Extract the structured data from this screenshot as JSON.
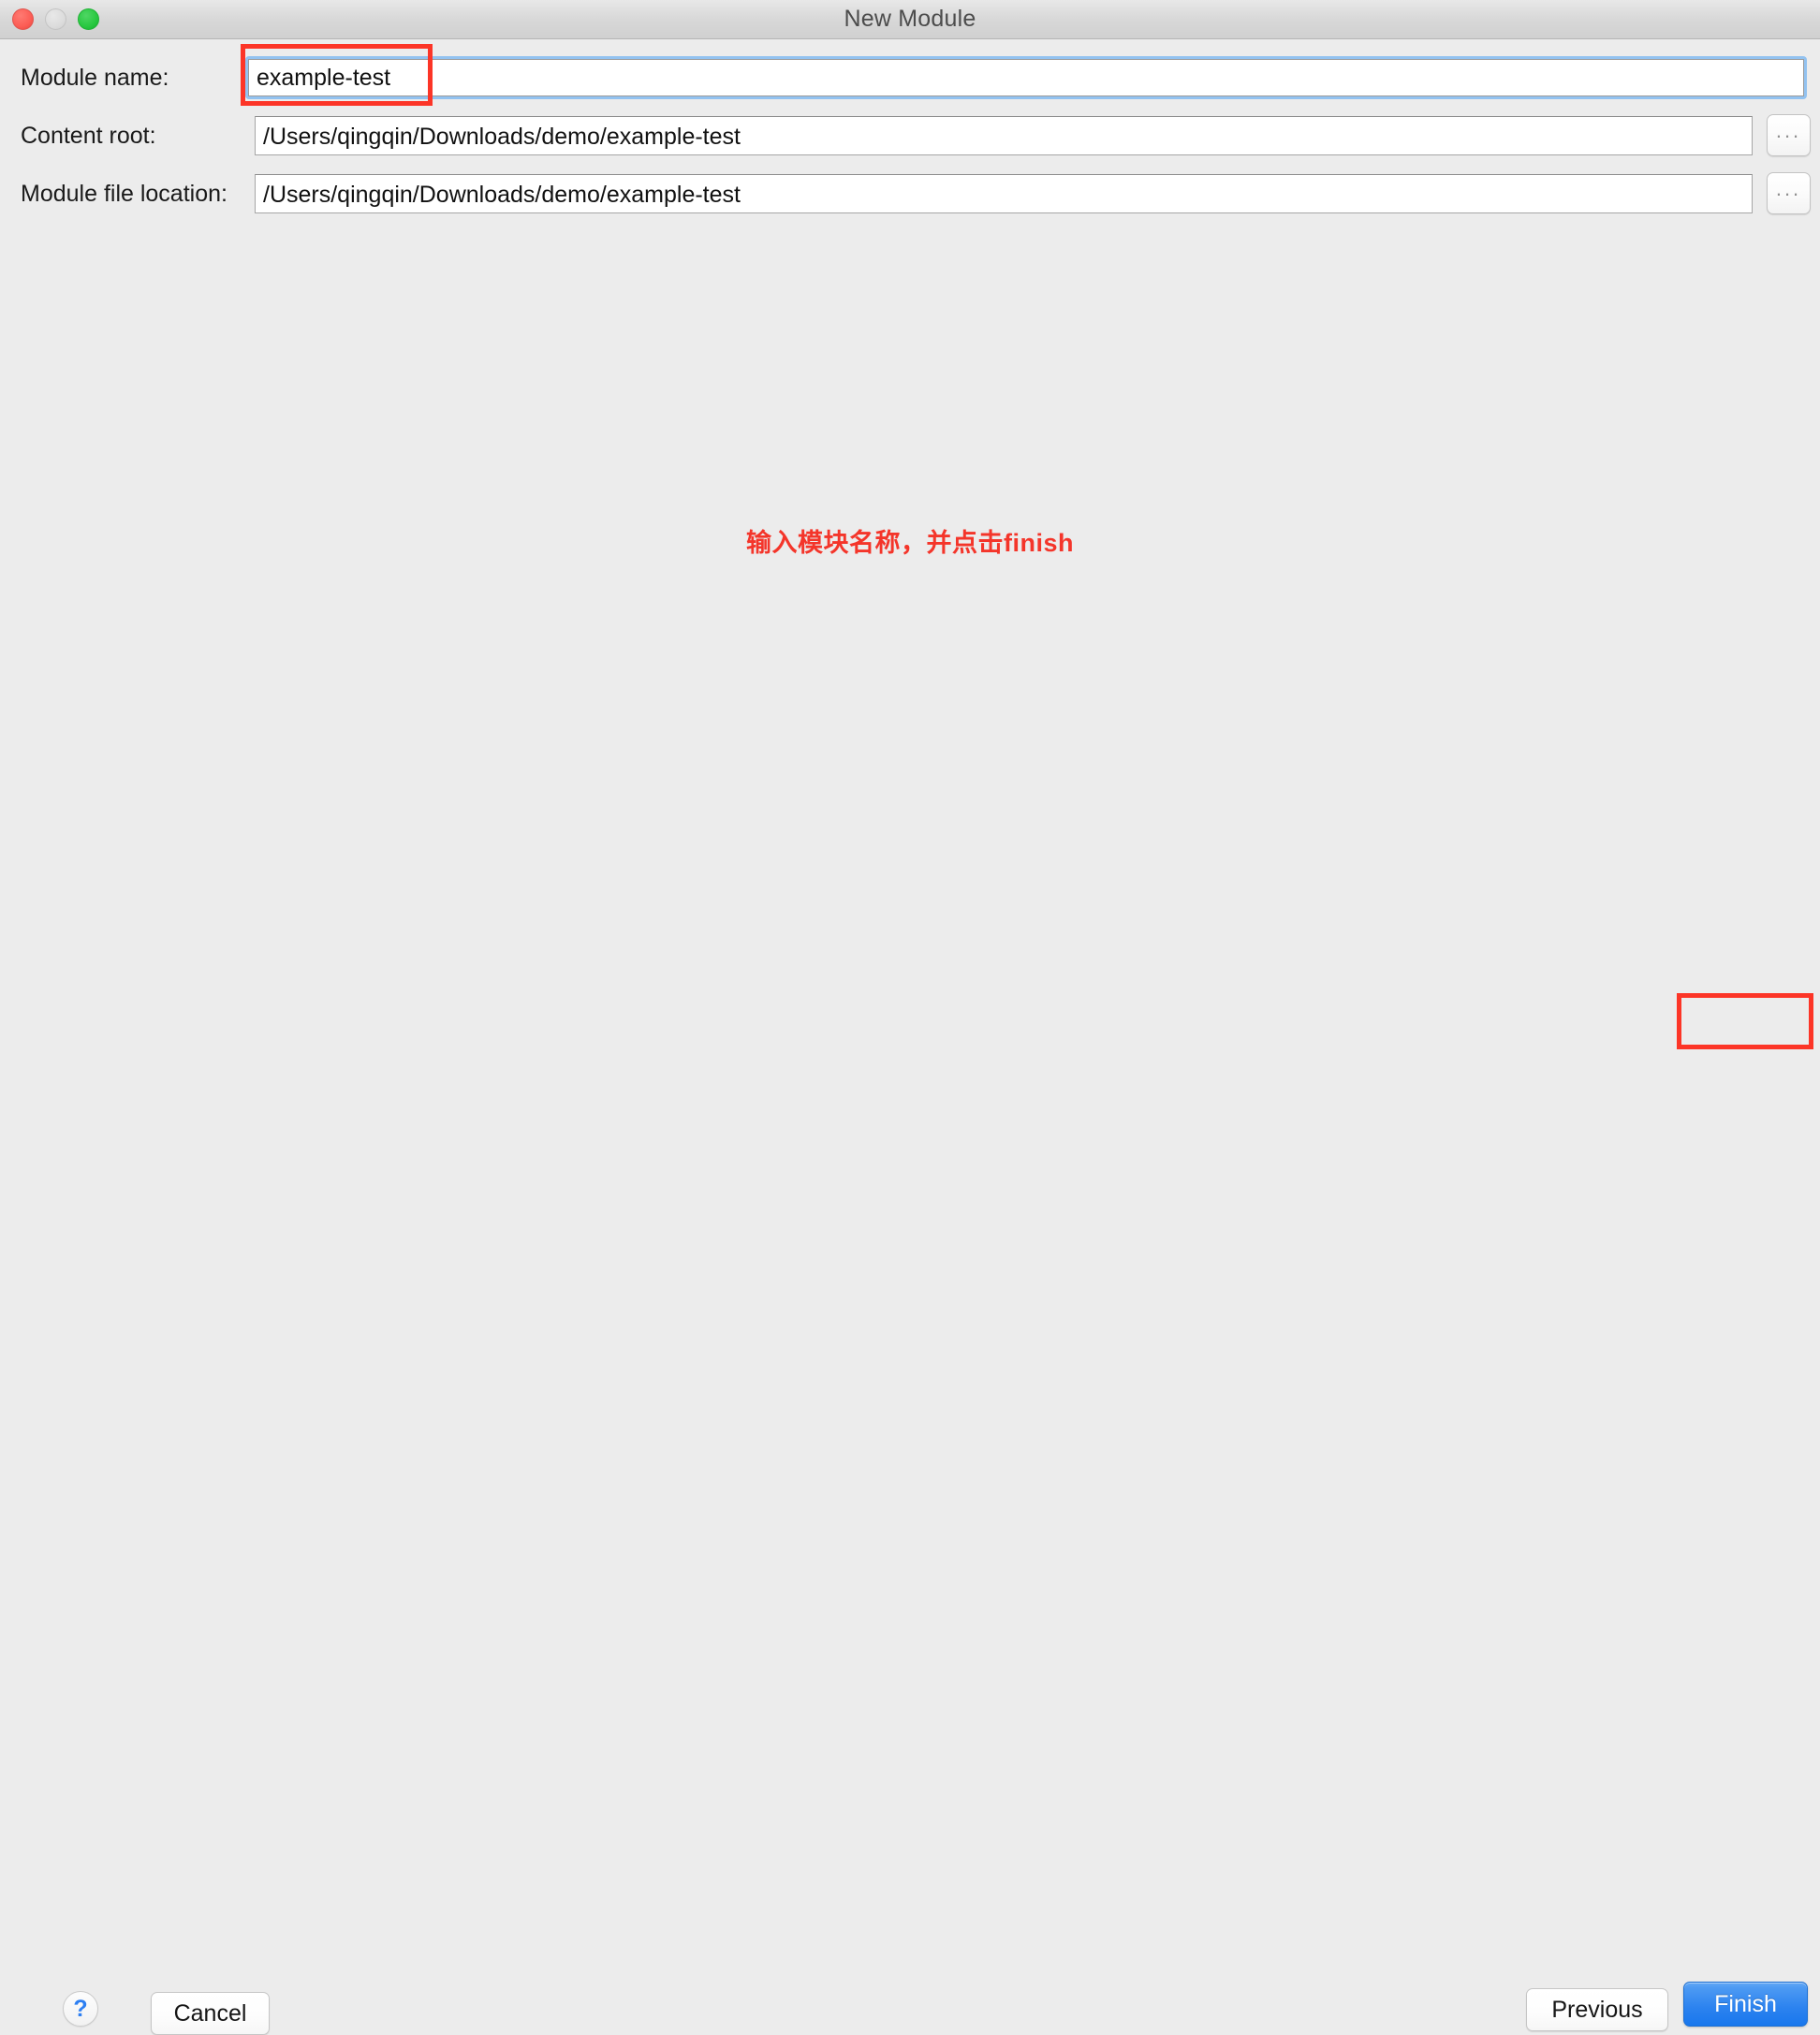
{
  "window": {
    "title": "New Module",
    "traffic_lights": [
      {
        "name": "close",
        "color": "#fc5d55"
      },
      {
        "name": "minimize",
        "color": "#dcdcdc"
      },
      {
        "name": "zoom",
        "color": "#28c840"
      }
    ]
  },
  "form": {
    "rows": [
      {
        "label": "Module name:",
        "value": "example-test",
        "placeholder": "",
        "focused": true,
        "has_browse": false
      },
      {
        "label": "Content root:",
        "value": "/Users/qingqin/Downloads/demo/example-test",
        "placeholder": "",
        "focused": false,
        "has_browse": true,
        "browse_label": "..."
      },
      {
        "label": "Module file location:",
        "value": "/Users/qingqin/Downloads/demo/example-test",
        "placeholder": "",
        "focused": false,
        "has_browse": true,
        "browse_label": "..."
      }
    ]
  },
  "annotation": {
    "text": "输入模块名称，并点击finish",
    "color": "#f4352a",
    "box_color": "#fc3527",
    "highlights": [
      "module-name-field",
      "finish-button"
    ]
  },
  "footer": {
    "help_label": "?",
    "cancel_label": "Cancel",
    "previous_label": "Previous",
    "finish_label": "Finish",
    "finish_accent": "#1877ed"
  }
}
